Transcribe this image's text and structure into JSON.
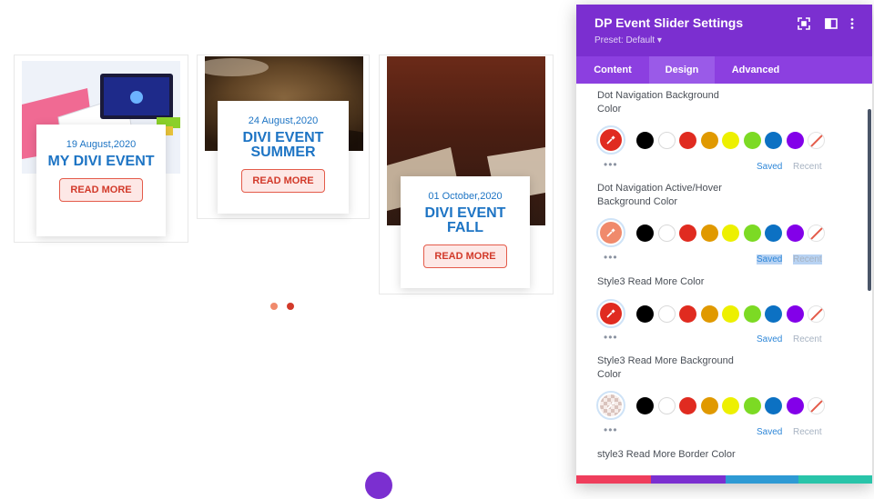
{
  "events": [
    {
      "date": "19 August,2020",
      "title": "MY DIVI EVENT",
      "button": "READ MORE",
      "image": "laptop-screens"
    },
    {
      "date": "24 August,2020",
      "title": "DIVI EVENT SUMMER",
      "button": "READ MORE",
      "image": "coffee-grounds"
    },
    {
      "date": "01 October,2020",
      "title": "DIVI EVENT FALL",
      "button": "READ MORE",
      "image": "wood-table"
    }
  ],
  "slider_dots": {
    "count": 2,
    "active_index": 1,
    "inactive_color": "#f08a6c",
    "active_color": "#d23a2a"
  },
  "panel": {
    "title": "DP Event Slider Settings",
    "preset": "Preset: Default ▾",
    "header_icons": [
      "expand-icon",
      "sidebar-icon",
      "kebab-menu-icon"
    ],
    "tabs": [
      {
        "label": "Content",
        "active": false
      },
      {
        "label": "Design",
        "active": true
      },
      {
        "label": "Advanced",
        "active": false
      }
    ],
    "palette": [
      "#000000",
      "#ffffff",
      "#e02b20",
      "#e09900",
      "#edf000",
      "#7cda24",
      "#0c71c3",
      "#8300e9",
      "none"
    ],
    "saved_label": "Saved",
    "recent_label": "Recent",
    "more_label": "•••",
    "settings": [
      {
        "label": "Dot Navigation Background Color",
        "current_color": "#e02b20",
        "selected": false
      },
      {
        "label": "Dot Navigation Active/Hover Background Color",
        "current_color": "#f08a6c",
        "selected": true
      },
      {
        "label": "Style3 Read More Color",
        "current_color": "#e02b20",
        "selected": false
      },
      {
        "label": "Style3 Read More Background Color",
        "current_color": "transparent",
        "selected": false
      },
      {
        "label": "style3 Read More Border Color",
        "current_color": "#e02b20",
        "selected": false
      }
    ]
  },
  "colors": {
    "accent": "#7b2fd0",
    "tab_bar": "#8c3fe0",
    "link": "#1d74c4",
    "read_more": "#d23a2a"
  }
}
